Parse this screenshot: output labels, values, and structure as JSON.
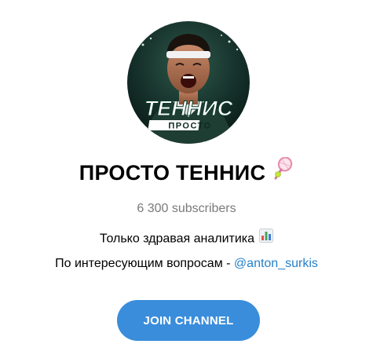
{
  "channel": {
    "name": "ПРОСТО ТЕННИС",
    "name_emoji": "tennis-racket-icon",
    "subscribers": "6 300 subscribers",
    "avatar": {
      "logo_line1": "ТЕННИС",
      "logo_line2": "ПРОСТО"
    },
    "description": {
      "line1": "Только здравая аналитика",
      "line1_emoji": "bar-chart-icon",
      "line2_prefix": "По интересующим вопросам - ",
      "line2_mention": "@anton_surkis"
    }
  },
  "actions": {
    "join_label": "JOIN CHANNEL"
  },
  "colors": {
    "accent": "#3a8ddb",
    "link": "#2481cc",
    "muted_text": "#7a7a7a"
  }
}
